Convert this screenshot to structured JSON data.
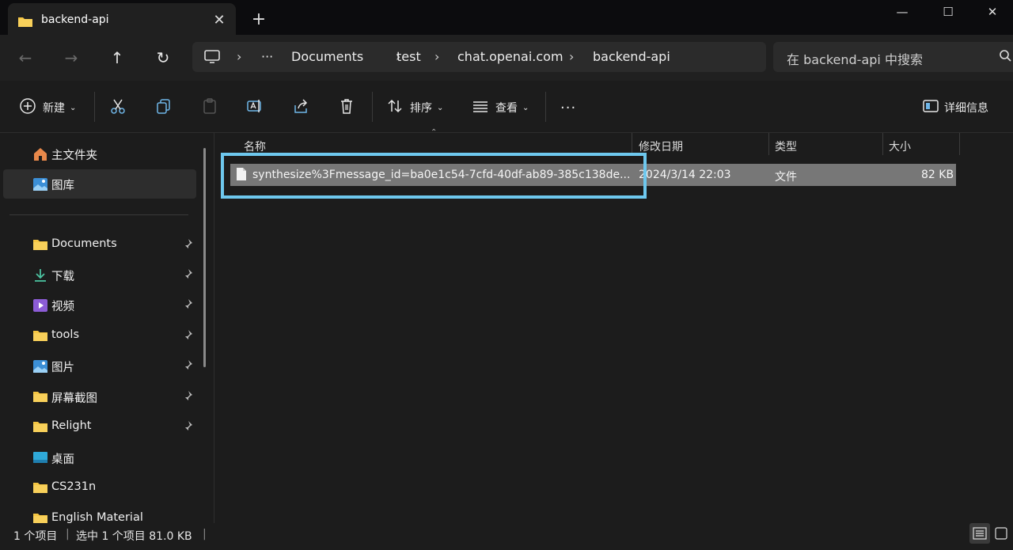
{
  "window": {
    "tab_title": "backend-api",
    "icons": [
      "folder-icon",
      "close-icon",
      "plus-icon",
      "minimize-icon",
      "maximize-icon",
      "window-close-icon"
    ]
  },
  "address": {
    "crumbs": [
      "Documents",
      "test",
      "chat.openai.com",
      "backend-api"
    ],
    "ellipsis": "···",
    "search_placeholder": "在 backend-api 中搜索"
  },
  "toolbar": {
    "new_label": "新建",
    "sort_label": "排序",
    "view_label": "查看",
    "more_label": "···",
    "details_label": "详细信息"
  },
  "sidebar": {
    "home_label": "主文件夹",
    "gallery_label": "图库",
    "items": [
      {
        "label": "Documents",
        "icon": "folder-icon",
        "pinned": true
      },
      {
        "label": "下载",
        "icon": "download-icon",
        "pinned": true
      },
      {
        "label": "视频",
        "icon": "video-icon",
        "pinned": true
      },
      {
        "label": "tools",
        "icon": "folder-icon",
        "pinned": true
      },
      {
        "label": "图片",
        "icon": "picture-icon",
        "pinned": true
      },
      {
        "label": "屏幕截图",
        "icon": "folder-icon",
        "pinned": true
      },
      {
        "label": "Relight",
        "icon": "folder-icon",
        "pinned": true
      },
      {
        "label": "桌面",
        "icon": "desktop-icon",
        "pinned": false
      },
      {
        "label": "CS231n",
        "icon": "folder-icon",
        "pinned": false
      },
      {
        "label": "English Material",
        "icon": "folder-icon",
        "pinned": false
      }
    ]
  },
  "columns": {
    "name": "名称",
    "date": "修改日期",
    "type": "类型",
    "size": "大小"
  },
  "files": [
    {
      "name": "synthesize%3Fmessage_id=ba0e1c54-7cfd-40df-ab89-385c138de...",
      "date": "2024/3/14 22:03",
      "type": "文件",
      "size": "82 KB"
    }
  ],
  "status": {
    "count": "1 个项目",
    "selection": "选中 1 个项目  81.0 KB"
  },
  "colors": {
    "accent_highlight": "#6ec8ee",
    "selected_row": "#777777",
    "folder": "#f4c542"
  }
}
